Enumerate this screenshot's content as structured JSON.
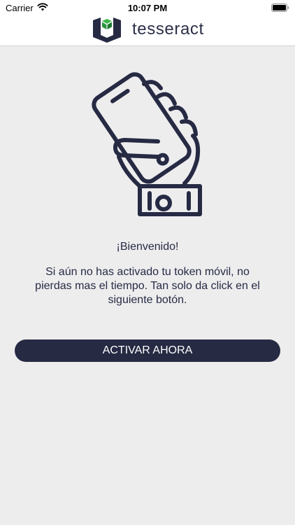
{
  "status_bar": {
    "carrier": "Carrier",
    "time": "10:07 PM",
    "icons": [
      "wifi-icon",
      "battery-icon"
    ]
  },
  "header": {
    "brand": "tesseract",
    "logo_icon": "tesseract-logo-icon",
    "colors": {
      "logo_dark": "#262a43",
      "logo_accent": "#3bb54a"
    }
  },
  "main": {
    "illustration_icon": "hand-holding-phone-icon",
    "welcome": "¡Bienvenido!",
    "message": "Si aún no has activado tu token móvil, no pierdas mas el tiempo. Tan solo da click en el siguiente botón.",
    "button_label": "ACTIVAR AHORA"
  },
  "colors": {
    "background": "#ededee",
    "primary": "#262a43",
    "button_text": "#ffffff"
  }
}
